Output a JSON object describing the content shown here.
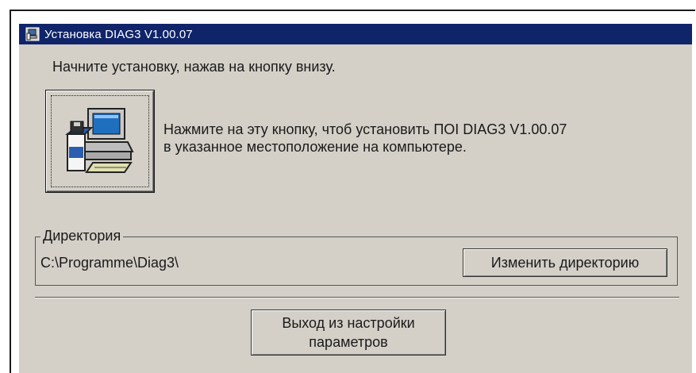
{
  "window": {
    "title": "Установка DIAG3 V1.00.07",
    "title_icon": "installer-icon",
    "titlebar_color": "#10246a",
    "background_color": "#d4d0c8"
  },
  "main": {
    "instruction": "Начните установку, нажав на кнопку внизу.",
    "install_button_icon": "computer-setup-icon",
    "description_line1": "Нажмите на эту кнопку, чтоб установить ПОI DIAG3 V1.00.07",
    "description_line2": "в указанное местоположение на компьютере."
  },
  "directory": {
    "label": "Директория",
    "path": "C:\\Programme\\Diag3\\",
    "change_button_label": "Изменить директорию"
  },
  "footer": {
    "exit_button_line1": "Выход из настройки",
    "exit_button_line2": "параметров"
  }
}
